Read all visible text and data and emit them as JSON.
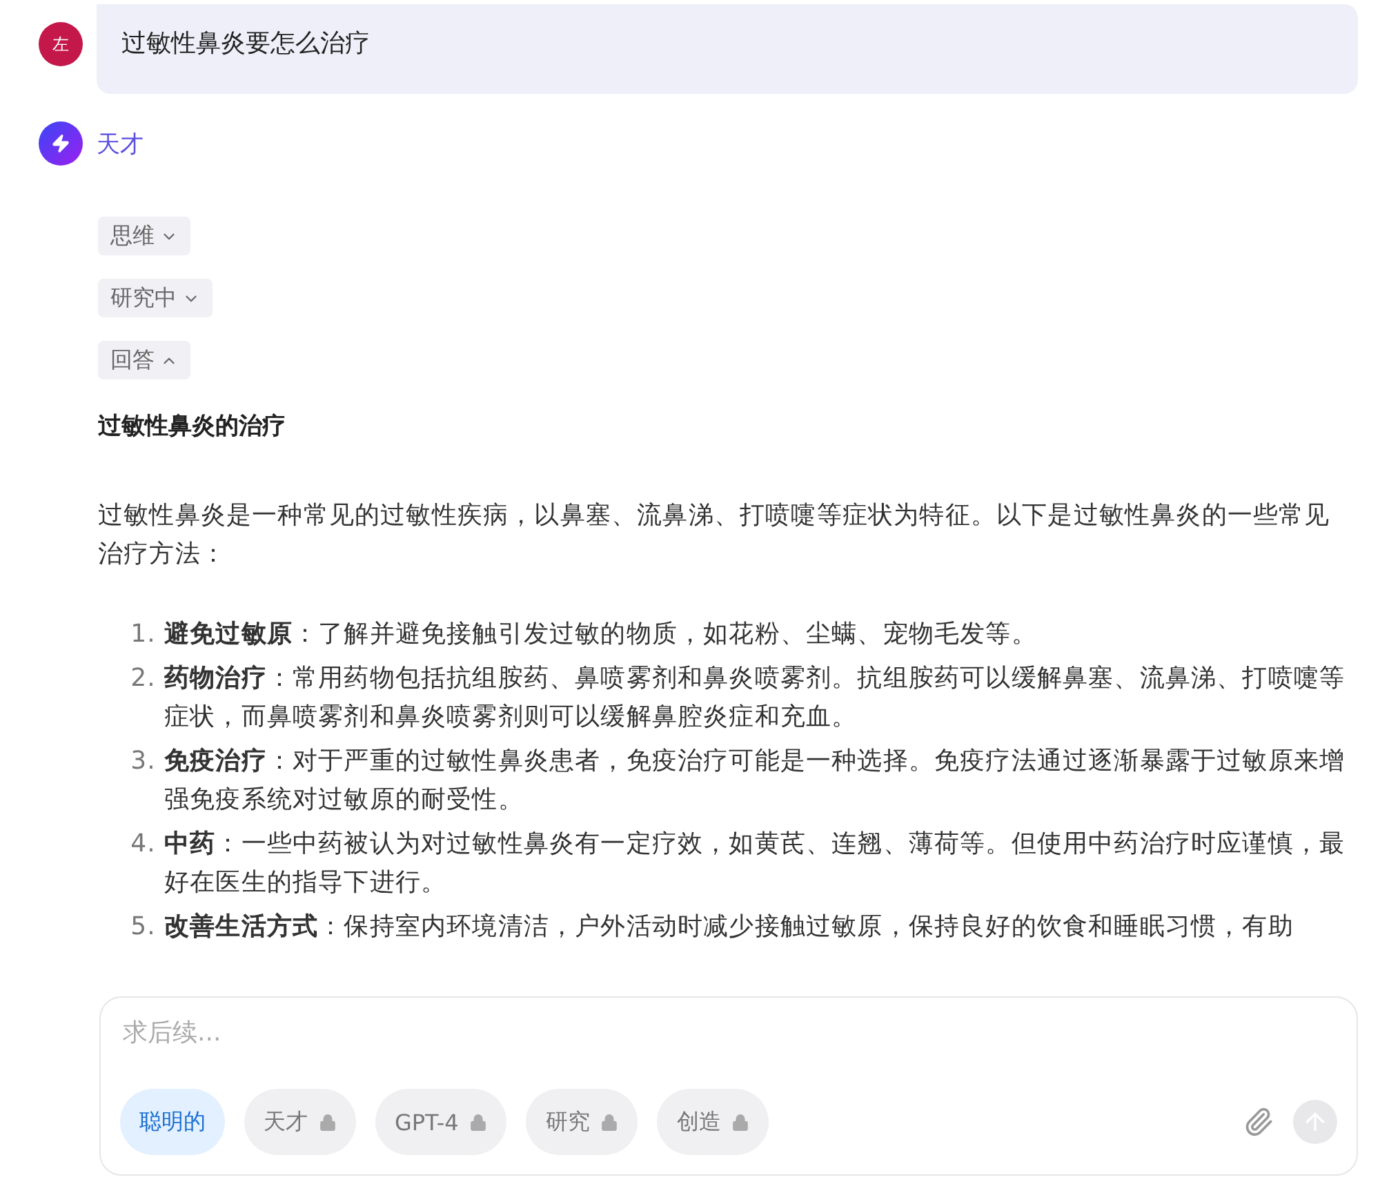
{
  "user_message": {
    "avatar": "左",
    "text": "过敏性鼻炎要怎么治疗"
  },
  "assistant": {
    "name": "天才"
  },
  "toggles": [
    {
      "label": "思维",
      "expanded": false
    },
    {
      "label": "研究中",
      "expanded": false
    },
    {
      "label": "回答",
      "expanded": true
    }
  ],
  "answer": {
    "title": "过敏性鼻炎的治疗",
    "intro": "过敏性鼻炎是一种常见的过敏性疾病，以鼻塞、流鼻涕、打喷嚏等症状为特征。以下是过敏性鼻炎的一些常见治疗方法：",
    "items": [
      {
        "number": "1.",
        "text": "**避免过敏原**：了解并避免接触引发过敏的物质，如花粉、尘螨、宠物毛发等。"
      },
      {
        "number": "2.",
        "text": "**药物治疗**：常用药物包括抗组胺药、鼻喷雾剂和鼻炎喷雾剂。抗组胺药可以缓解鼻塞、流鼻涕、打喷嚏等症状，而鼻喷雾剂和鼻炎喷雾剂则可以缓解鼻腔炎症和充血。"
      },
      {
        "number": "3.",
        "text": "**免疫治疗**：对于严重的过敏性鼻炎患者，免疫治疗可能是一种选择。免疫疗法通过逐渐暴露于过敏原来增强免疫系统对过敏原的耐受性。"
      },
      {
        "number": "4.",
        "text": "**中药**：一些中药被认为对过敏性鼻炎有一定疗效，如黄芪、连翘、薄荷等。但使用中药治疗时应谨慎，最好在医生的指导下进行。"
      },
      {
        "number": "5.",
        "text": "**改善生活方式**：保持室内环境清洁，户外活动时减少接触过敏原，保持良好的饮食和睡眠习惯，有助"
      }
    ]
  },
  "composer": {
    "placeholder": "求后续...",
    "models": [
      {
        "label": "聪明的",
        "selected": true,
        "locked": false
      },
      {
        "label": "天才",
        "selected": false,
        "locked": true
      },
      {
        "label": "GPT-4",
        "selected": false,
        "locked": true
      },
      {
        "label": "研究",
        "selected": false,
        "locked": true
      },
      {
        "label": "创造",
        "selected": false,
        "locked": true
      }
    ]
  }
}
